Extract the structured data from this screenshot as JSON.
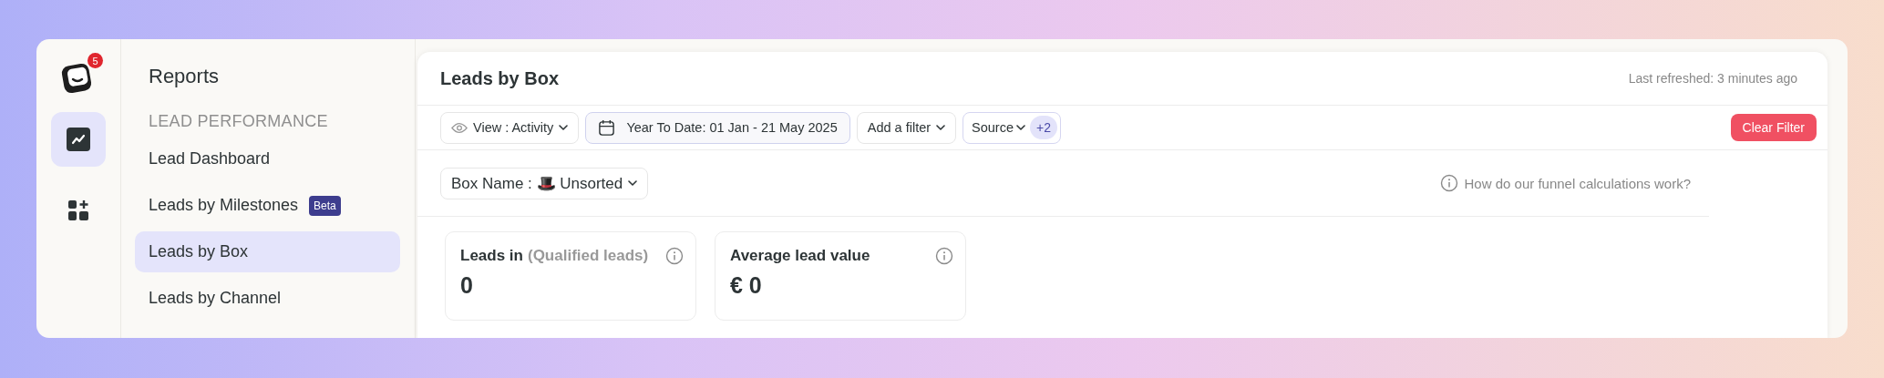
{
  "rail": {
    "badge": "5",
    "items": [
      {
        "kind": "reports",
        "selected": true
      },
      {
        "kind": "apps",
        "selected": false
      }
    ]
  },
  "sidebar": {
    "title": "Reports",
    "section": "LEAD PERFORMANCE",
    "items": [
      {
        "label": "Lead Dashboard",
        "selected": false
      },
      {
        "label": "Leads by Milestones",
        "badge": "Beta",
        "selected": false
      },
      {
        "label": "Leads by Box",
        "selected": true
      },
      {
        "label": "Leads by Channel",
        "selected": false
      }
    ]
  },
  "main": {
    "title": "Leads by Box",
    "last_refreshed": "Last refreshed: 3 minutes ago",
    "filters": [
      {
        "kind": "view",
        "label": "View : Activity"
      },
      {
        "kind": "date",
        "label": "Year To Date: 01 Jan - 21 May 2025"
      },
      {
        "kind": "add",
        "label": "Add a filter"
      },
      {
        "kind": "source",
        "label": "Source",
        "count": "+2"
      }
    ],
    "clear_button": "Clear Filter",
    "box_name": {
      "label": "Box Name :",
      "emoji": "🎩",
      "value": "Unsorted"
    },
    "help_link": "How do our funnel calculations work?",
    "cards": [
      {
        "title": "Leads in",
        "subtitle": "(Qualified leads)",
        "value": "0"
      },
      {
        "title": "Average lead value",
        "value": "€ 0"
      }
    ]
  }
}
